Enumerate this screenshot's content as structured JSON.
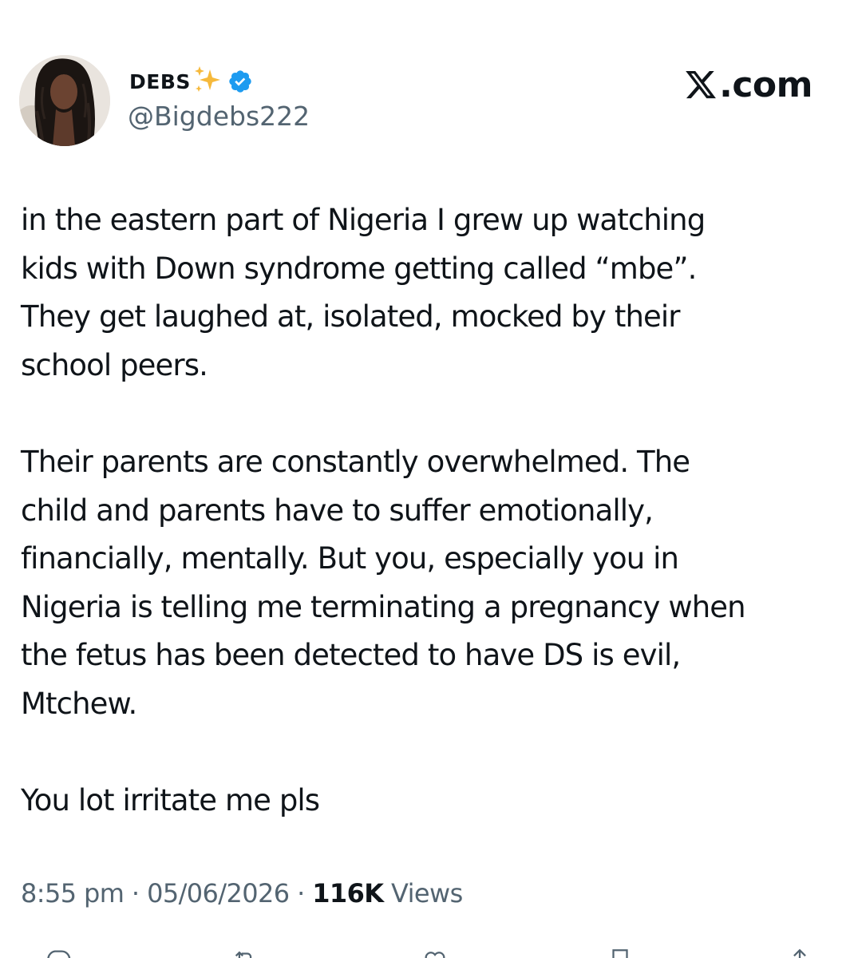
{
  "author": {
    "display_name": "DEBS",
    "handle": "@Bigdebs222",
    "avatar_icon": "profile-photo",
    "badge_icon": "verified-badge-icon",
    "badge_color": "#1d9bf0",
    "emoji_icon": "sparkles-icon"
  },
  "brand": {
    "logo_icon": "x-logo-icon",
    "suffix": ".com"
  },
  "tweet": {
    "paragraphs": [
      "in the eastern part of Nigeria I grew up watching kids with Down syndrome getting called “mbe”. They get laughed at, isolated, mocked by their school peers.",
      "Their parents are constantly overwhelmed. The child and parents have to suffer emotionally, financially, mentally. But you, especially you in Nigeria is telling me terminating a pregnancy when the fetus has been detected to have DS is evil, Mtchew.",
      "You lot irritate me pls"
    ],
    "paragraph_lines": [
      "in the eastern part of Nigeria I grew up watching\nkids with Down syndrome getting called “mbe”.\nThey get laughed at, isolated, mocked by their\nschool peers.",
      "Their parents are constantly overwhelmed. The\nchild and parents have to suffer emotionally,\nfinancially, mentally. But you, especially you in\nNigeria is telling me terminating a pregnancy when\nthe fetus has been detected to have DS is evil,\nMtchew.",
      "You lot irritate me pls"
    ]
  },
  "meta": {
    "time": "8:55 pm",
    "separator": "·",
    "date": "05/06/2026",
    "views_count": "116K",
    "views_label": "Views"
  },
  "colors": {
    "text_primary": "#0f1419",
    "text_secondary": "#536471",
    "accent": "#1d9bf0"
  }
}
